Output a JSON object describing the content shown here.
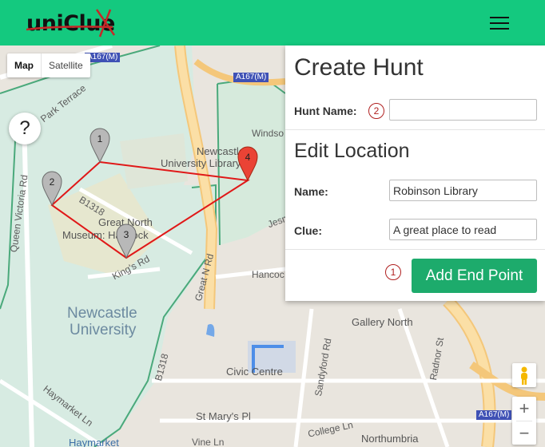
{
  "app": {
    "logo_text": "uniClue",
    "brand_color": "#14c97f"
  },
  "map": {
    "type_controls": [
      "Map",
      "Satellite"
    ],
    "help_label": "?",
    "zoom_in": "+",
    "zoom_out": "−",
    "labels": {
      "a167m_1": "A167(M)",
      "a167m_2": "A167(M)",
      "a167m_3": "A167(M)",
      "park_terrace": "Park Terrace",
      "queen_victoria_rd": "Queen Victoria Rd",
      "b1318_1": "B1318",
      "b1318_2": "B1318",
      "great_north_museum_1": "Great North",
      "great_north_museum_2": "Museum: Hancock",
      "kings_rd": "King's Rd",
      "newcastle_university_1": "Newcastle",
      "newcastle_university_2": "University",
      "newcastle_library_1": "Newcastle",
      "newcastle_library_2": "University Library",
      "windsor": "Windso",
      "jesmond": "Jesm",
      "great_n_rd": "Great N Rd",
      "hancock": "Hancoc",
      "gallery_north": "Gallery North",
      "civic_centre": "Civic Centre",
      "sandyford_rd": "Sandyford Rd",
      "college_ln": "College Ln",
      "radnor_st": "Radnor St",
      "haymarket_ln": "Haymarket Ln",
      "st_marys_pl": "St Mary's Pl",
      "vine_ln": "Vine Ln",
      "haymarket": "Haymarket",
      "northumbria": "Northumbria"
    },
    "markers": [
      "1",
      "2",
      "3",
      "4"
    ]
  },
  "panel": {
    "create_title": "Create Hunt",
    "hunt_name_label": "Hunt Name:",
    "hunt_name_value": "",
    "hunt_name_step": "2",
    "edit_title": "Edit Location",
    "name_label": "Name:",
    "name_value": "Robinson Library",
    "clue_label": "Clue:",
    "clue_value": "A great place to read",
    "add_step": "1",
    "add_button": "Add End Point"
  }
}
